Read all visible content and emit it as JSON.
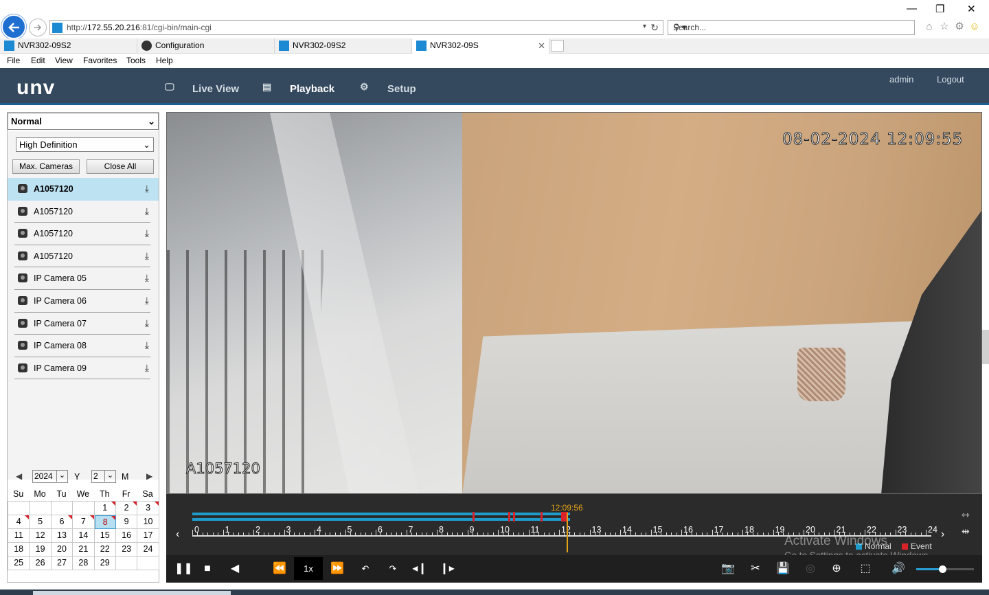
{
  "browser": {
    "url_prefix": "http://",
    "url_host": "172.55.20.216",
    "url_rest": ":81/cgi-bin/main-cgi",
    "search_placeholder": "Search...",
    "tabs": [
      {
        "label": "NVR302-09S2"
      },
      {
        "label": "Configuration"
      },
      {
        "label": "NVR302-09S2"
      },
      {
        "label": "NVR302-09S"
      }
    ],
    "menu": [
      "File",
      "Edit",
      "View",
      "Favorites",
      "Tools",
      "Help"
    ]
  },
  "app": {
    "logo": "unv",
    "nav": [
      {
        "label": "Live View",
        "icon": "monitor-icon"
      },
      {
        "label": "Playback",
        "icon": "film-icon"
      },
      {
        "label": "Setup",
        "icon": "gear-icon"
      }
    ],
    "user": "admin",
    "logout": "Logout"
  },
  "left": {
    "mode": "Normal",
    "quality": "High Definition",
    "max_cameras": "Max. Cameras",
    "close_all": "Close All",
    "cameras": [
      {
        "name": "A1057120",
        "selected": true
      },
      {
        "name": "A1057120"
      },
      {
        "name": "A1057120"
      },
      {
        "name": "A1057120"
      },
      {
        "name": "IP Camera 05"
      },
      {
        "name": "IP Camera 06"
      },
      {
        "name": "IP Camera 07"
      },
      {
        "name": "IP Camera 08"
      },
      {
        "name": "IP Camera 09"
      }
    ]
  },
  "calendar": {
    "year": "2024",
    "year_label": "Y",
    "month": "2",
    "month_label": "M",
    "dow": [
      "Su",
      "Mo",
      "Tu",
      "We",
      "Th",
      "Fr",
      "Sa"
    ],
    "selected_day": "8",
    "days": [
      "",
      "",
      "",
      "",
      "1",
      "2",
      "3",
      "4",
      "5",
      "6",
      "7",
      "8",
      "9",
      "10",
      "11",
      "12",
      "13",
      "14",
      "15",
      "16",
      "17",
      "18",
      "19",
      "20",
      "21",
      "22",
      "23",
      "24",
      "25",
      "26",
      "27",
      "28",
      "29",
      "",
      ""
    ],
    "recorded_days": [
      "1",
      "2",
      "3",
      "4",
      "6",
      "7",
      "8"
    ]
  },
  "video": {
    "timestamp": "08-02-2024 12:09:55",
    "camera_label": "A1057120"
  },
  "timeline": {
    "current_time": "12:09:56",
    "hours": [
      "0",
      "1",
      "2",
      "3",
      "4",
      "5",
      "6",
      "7",
      "8",
      "9",
      "10",
      "11",
      "12",
      "13",
      "14",
      "15",
      "16",
      "17",
      "18",
      "19",
      "20",
      "21",
      "22",
      "23",
      "24"
    ],
    "legend_normal": "Normal",
    "legend_event": "Event",
    "normal_color": "#1e9ccc",
    "event_color": "#d9232b",
    "speed": "1x",
    "volume_level": 0.45
  },
  "watermark": {
    "line1": "Activate Windows",
    "line2": "Go to Settings to activate Windows."
  }
}
